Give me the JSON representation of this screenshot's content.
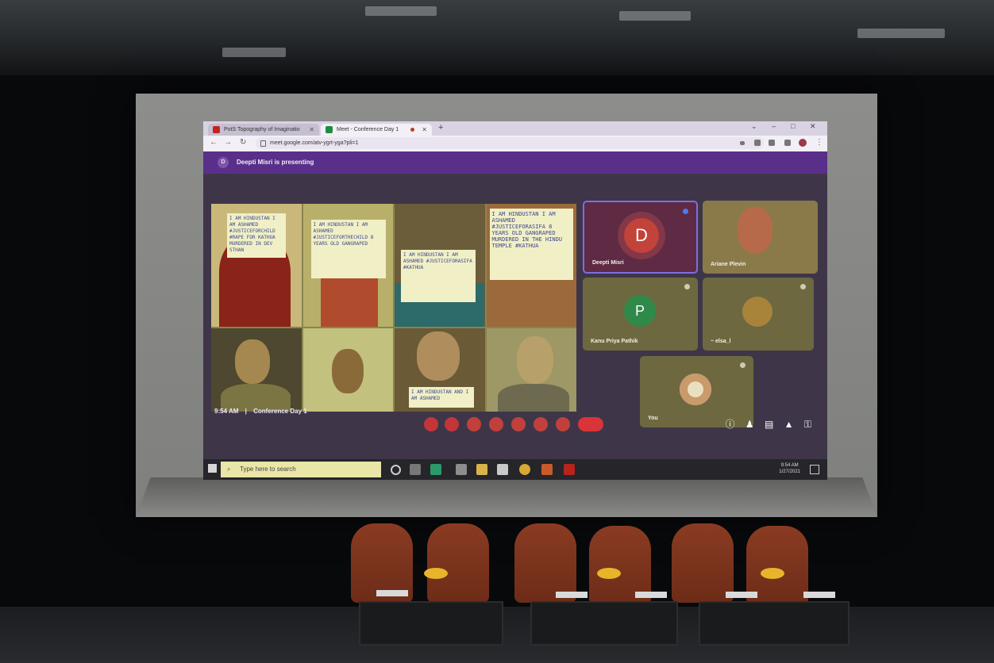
{
  "browser": {
    "tabs": [
      {
        "label": "PotS Topography of Imaginatio",
        "icon": "gmail-icon"
      },
      {
        "label": "Meet - Conference Day 1",
        "icon": "meet-icon"
      }
    ],
    "url": "meet.google.com/atv-ygrt-yga?pli=1"
  },
  "meet": {
    "presenter_initial": "D",
    "presenting_text": "Deepti Misri is presenting",
    "tiles": [
      {
        "name": "Deepti Misri",
        "initial": "D"
      },
      {
        "name": "Ariane Plevin"
      },
      {
        "name": "Kanu Priya Pathik",
        "initial": "P"
      },
      {
        "name": "~ elsa_l"
      },
      {
        "name": "You"
      }
    ],
    "time": "9:54 AM",
    "separator": "|",
    "meeting_title": "Conference Day 1"
  },
  "slide_signs": [
    "I AM HINDUSTAN I AM ASHAMED #JUSTICEFORCHILD #RAPE FOR KATHUA MURDERED IN DEV STHAN",
    "I AM HINDUSTAN I AM ASHAMED #JUSTICEFORTHECHILD 8 YEARS OLD GANGRAPED",
    "I AM HINDUSTAN I AM ASHAMED #JUSTICEFORASIFA #KATHUA",
    "I AM HINDUSTAN I AM ASHAMED #JUSTICEFORASIFA 8 YEARS OLD GANGRAPED MURDERED IN THE HINDU TEMPLE #KATHUA",
    "I AM HINDUSTAN AND I AM ASHAMED"
  ],
  "taskbar": {
    "search_placeholder": "Type here to search",
    "time": "9:54 AM",
    "date": "1/27/2021"
  },
  "colors": {
    "banner": "#5a2f8a",
    "end_call": "#c4353a",
    "chairs": "#8a3b22"
  }
}
